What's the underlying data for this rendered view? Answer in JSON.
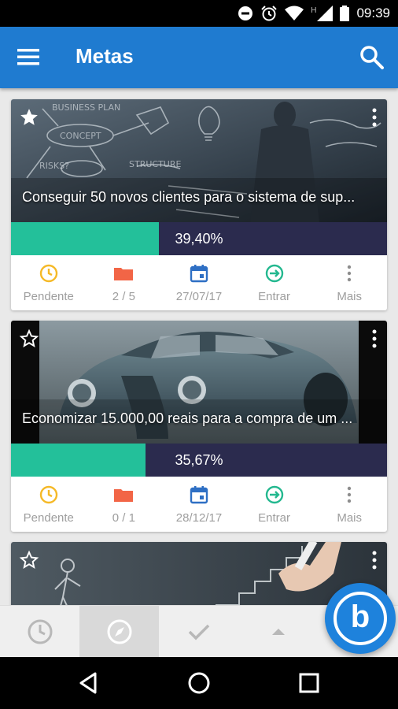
{
  "status_bar": {
    "time": "09:39",
    "network_label": "H",
    "icons": [
      "do-not-disturb-icon",
      "alarm-icon",
      "wifi-icon",
      "signal-icon",
      "battery-icon"
    ]
  },
  "app_bar": {
    "title": "Metas",
    "menu_icon": "hamburger-menu-icon",
    "search_icon": "search-icon",
    "color": "#1f7bd0"
  },
  "goals": [
    {
      "title": "Conseguir 50 novos clientes para o sistema de sup...",
      "progress_label": "39,40%",
      "progress": 0.394,
      "favorite": true,
      "actions": {
        "status": "Pendente",
        "tasks": "2 / 5",
        "date": "27/07/17",
        "enter": "Entrar",
        "more": "Mais"
      }
    },
    {
      "title": "Economizar 15.000,00 reais para a compra de um ...",
      "progress_label": "35,67%",
      "progress": 0.3567,
      "favorite": false,
      "actions": {
        "status": "Pendente",
        "tasks": "0 / 1",
        "date": "28/12/17",
        "enter": "Entrar",
        "more": "Mais"
      }
    },
    {
      "favorite": false
    }
  ],
  "colors": {
    "progress_fill": "#23c09a",
    "progress_track": "#2b2b4e",
    "pending": "#f5b927",
    "tasks": "#f26546",
    "date": "#2e6fc4",
    "enter": "#23b88f",
    "more": "#8d8d8d"
  },
  "bottom_nav": {
    "items": [
      "clock-icon",
      "compass-icon",
      "check-icon",
      "chevron-up-icon"
    ],
    "active_index": 1
  },
  "fab": {
    "icon": "b",
    "color": "#1e82dc"
  },
  "system_nav": [
    "back-icon",
    "home-icon",
    "recents-icon"
  ]
}
